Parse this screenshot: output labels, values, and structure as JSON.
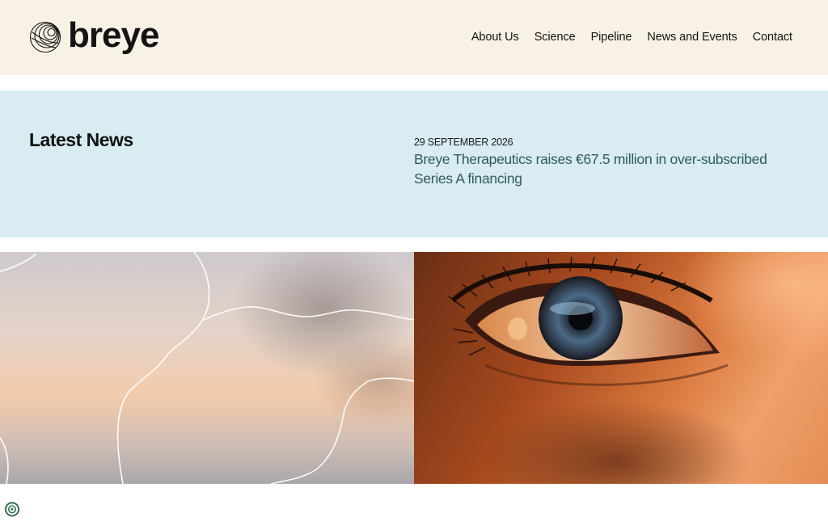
{
  "brand": {
    "name": "breye",
    "logo_icon": "concentric-sphere-icon"
  },
  "nav": {
    "items": [
      {
        "label": "About Us"
      },
      {
        "label": "Science"
      },
      {
        "label": "Pipeline"
      },
      {
        "label": "News and Events"
      },
      {
        "label": "Contact"
      }
    ]
  },
  "latest_news": {
    "heading": "Latest News",
    "date": "29 SEPTEMBER 2026",
    "title": "Breye Therapeutics raises €67.5 million in over-subscribed Series A financing"
  },
  "colors": {
    "header_bg": "#f8f1e5",
    "news_bg": "#d8ecf2",
    "news_link": "#2f5a60"
  },
  "footer": {
    "badge_icon": "cookie-settings-icon"
  }
}
